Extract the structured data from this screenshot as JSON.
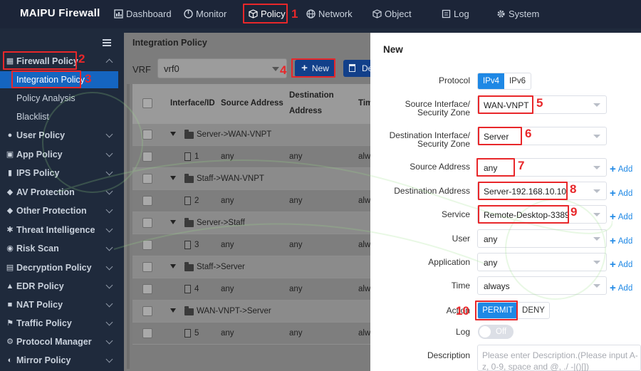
{
  "app": {
    "brand": "MAIPU Firewall"
  },
  "nav": [
    {
      "label": "Dashboard",
      "icon": "dashboard-icon"
    },
    {
      "label": "Monitor",
      "icon": "monitor-icon"
    },
    {
      "label": "Policy",
      "icon": "policy-cube-icon"
    },
    {
      "label": "Network",
      "icon": "network-globe-icon"
    },
    {
      "label": "Object",
      "icon": "object-cube-icon"
    },
    {
      "label": "Log",
      "icon": "log-icon"
    },
    {
      "label": "System",
      "icon": "system-gear-icon"
    }
  ],
  "annotations": [
    "1",
    "2",
    "3",
    "4",
    "5",
    "6",
    "7",
    "8",
    "9",
    "10"
  ],
  "sidebar": {
    "firewall_policy": "Firewall Policy",
    "subitems": [
      "Integration Policy",
      "Policy Analysis",
      "Blacklist"
    ],
    "items": [
      "User Policy",
      "App Policy",
      "IPS Policy",
      "AV Protection",
      "Other Protection",
      "Threat Intelligence",
      "Risk Scan",
      "Decryption Policy",
      "EDR Policy",
      "NAT Policy",
      "Traffic Policy",
      "Protocol Manager",
      "Mirror Policy"
    ]
  },
  "main": {
    "title": "Integration Policy",
    "vrf_label": "VRF",
    "vrf_value": "vrf0",
    "new_label": "New",
    "delete_label": "De",
    "columns": [
      "Interface/ID",
      "Source Address",
      "Destination",
      "Address",
      "Tim"
    ],
    "rows": [
      {
        "kind": "group",
        "name": "Server->WAN-VNPT"
      },
      {
        "kind": "child",
        "id": "1",
        "src": "any",
        "dst": "any",
        "time": "alw"
      },
      {
        "kind": "group",
        "name": "Staff->WAN-VNPT"
      },
      {
        "kind": "child",
        "id": "2",
        "src": "any",
        "dst": "any",
        "time": "alw"
      },
      {
        "kind": "group",
        "name": "Server->Staff"
      },
      {
        "kind": "child",
        "id": "3",
        "src": "any",
        "dst": "any",
        "time": "alw"
      },
      {
        "kind": "group",
        "name": "Staff->Server"
      },
      {
        "kind": "child",
        "id": "4",
        "src": "any",
        "dst": "any",
        "time": "alw"
      },
      {
        "kind": "group",
        "name": "WAN-VNPT->Server"
      },
      {
        "kind": "child",
        "id": "5",
        "src": "any",
        "dst": "any",
        "time": "alw"
      }
    ]
  },
  "dialog": {
    "title": "New",
    "protocol_label": "Protocol",
    "protocol_options": [
      "IPv4",
      "IPv6"
    ],
    "src_if_label": [
      "Source Interface/",
      "Security Zone"
    ],
    "src_if_value": "WAN-VNPT",
    "dst_if_label": [
      "Destination Interface/",
      "Security Zone"
    ],
    "dst_if_value": "Server",
    "src_addr_label": "Source Address",
    "src_addr_value": "any",
    "dst_addr_label": "Destination Address",
    "dst_addr_value": "Server-192.168.10.10",
    "service_label": "Service",
    "service_value": "Remote-Desktop-3389",
    "user_label": "User",
    "user_value": "any",
    "app_label": "Application",
    "app_value": "any",
    "time_label": "Time",
    "time_value": "always",
    "action_label": "Action",
    "action_options": [
      "PERMIT",
      "DENY"
    ],
    "log_label": "Log",
    "log_value": "Off",
    "desc_label": "Description",
    "desc_placeholder": "Please enter Description.(Please input A-z, 0-9, space and @, ./ -|()[])",
    "add_label": "Add"
  },
  "colors": {
    "accent": "#1e88e5",
    "annotation": "#e8272a",
    "sidebar_bg": "#1f2a3c",
    "active": "#1565c0"
  }
}
